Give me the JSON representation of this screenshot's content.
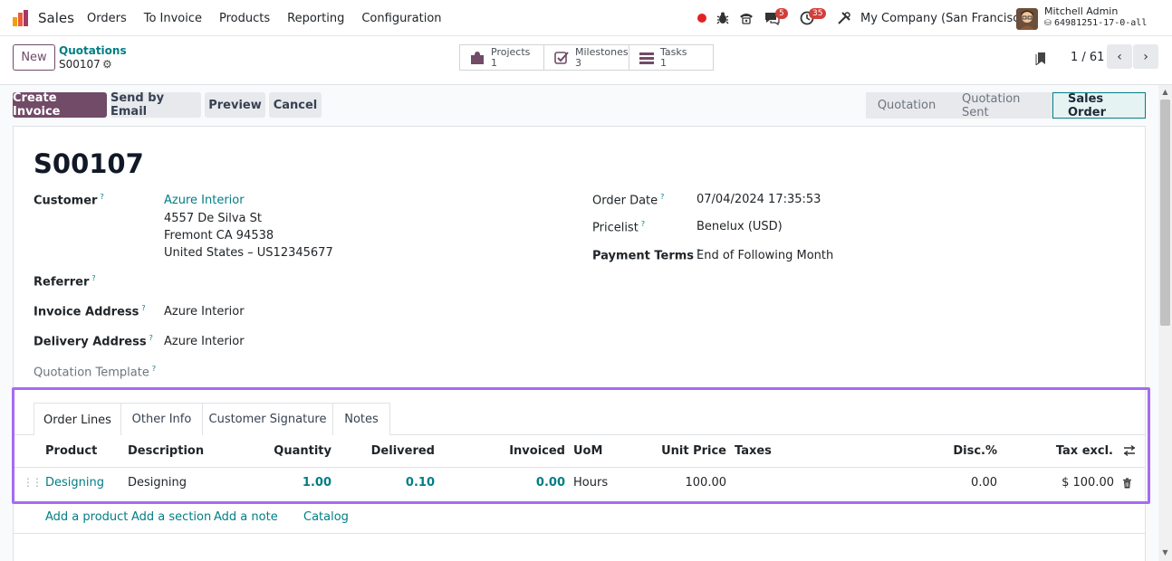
{
  "nav": {
    "app_name": "Sales",
    "menu": [
      "Orders",
      "To Invoice",
      "Products",
      "Reporting",
      "Configuration"
    ],
    "messages_count": "5",
    "activities_count": "35",
    "company": "My Company (San Francisco)",
    "user_name": "Mitchell Admin",
    "db_name": "64981251-17-0-all"
  },
  "control_panel": {
    "new_label": "New",
    "breadcrumb_parent": "Quotations",
    "breadcrumb_current": "S00107",
    "smart_buttons": [
      {
        "label": "Projects",
        "count": "1",
        "icon": "puzzle-icon"
      },
      {
        "label": "Milestones",
        "count": "3",
        "icon": "check-square-icon"
      },
      {
        "label": "Tasks",
        "count": "1",
        "icon": "tasks-icon"
      }
    ],
    "pager": "1 / 61"
  },
  "actions": {
    "create_invoice": "Create Invoice",
    "send_email": "Send by Email",
    "preview": "Preview",
    "cancel": "Cancel"
  },
  "statusbar": [
    "Quotation",
    "Quotation Sent",
    "Sales Order"
  ],
  "form": {
    "title": "S00107",
    "customer_label": "Customer",
    "customer_name": "Azure Interior",
    "customer_addr1": "4557 De Silva St",
    "customer_addr2": "Fremont CA 94538",
    "customer_addr3": "United States – US12345677",
    "referrer_label": "Referrer",
    "invoice_address_label": "Invoice Address",
    "invoice_address": "Azure Interior",
    "delivery_address_label": "Delivery Address",
    "delivery_address": "Azure Interior",
    "template_label": "Quotation Template",
    "order_date_label": "Order Date",
    "order_date": "07/04/2024 17:35:53",
    "pricelist_label": "Pricelist",
    "pricelist": "Benelux (USD)",
    "payment_terms_label": "Payment Terms",
    "payment_terms": "End of Following Month",
    "help_mark": "?"
  },
  "tabs": [
    "Order Lines",
    "Other Info",
    "Customer Signature",
    "Notes"
  ],
  "table": {
    "headers": [
      "Product",
      "Description",
      "Quantity",
      "Delivered",
      "Invoiced",
      "UoM",
      "Unit Price",
      "Taxes",
      "Disc.%",
      "Tax excl."
    ],
    "rows": [
      {
        "product": "Designing",
        "description": "Designing",
        "quantity": "1.00",
        "delivered": "0.10",
        "invoiced": "0.00",
        "uom": "Hours",
        "unit_price": "100.00",
        "taxes": "",
        "discount": "0.00",
        "subtotal": "$ 100.00"
      }
    ]
  },
  "add_links": [
    "Add a product",
    "Add a section",
    "Add a note",
    "Catalog"
  ]
}
